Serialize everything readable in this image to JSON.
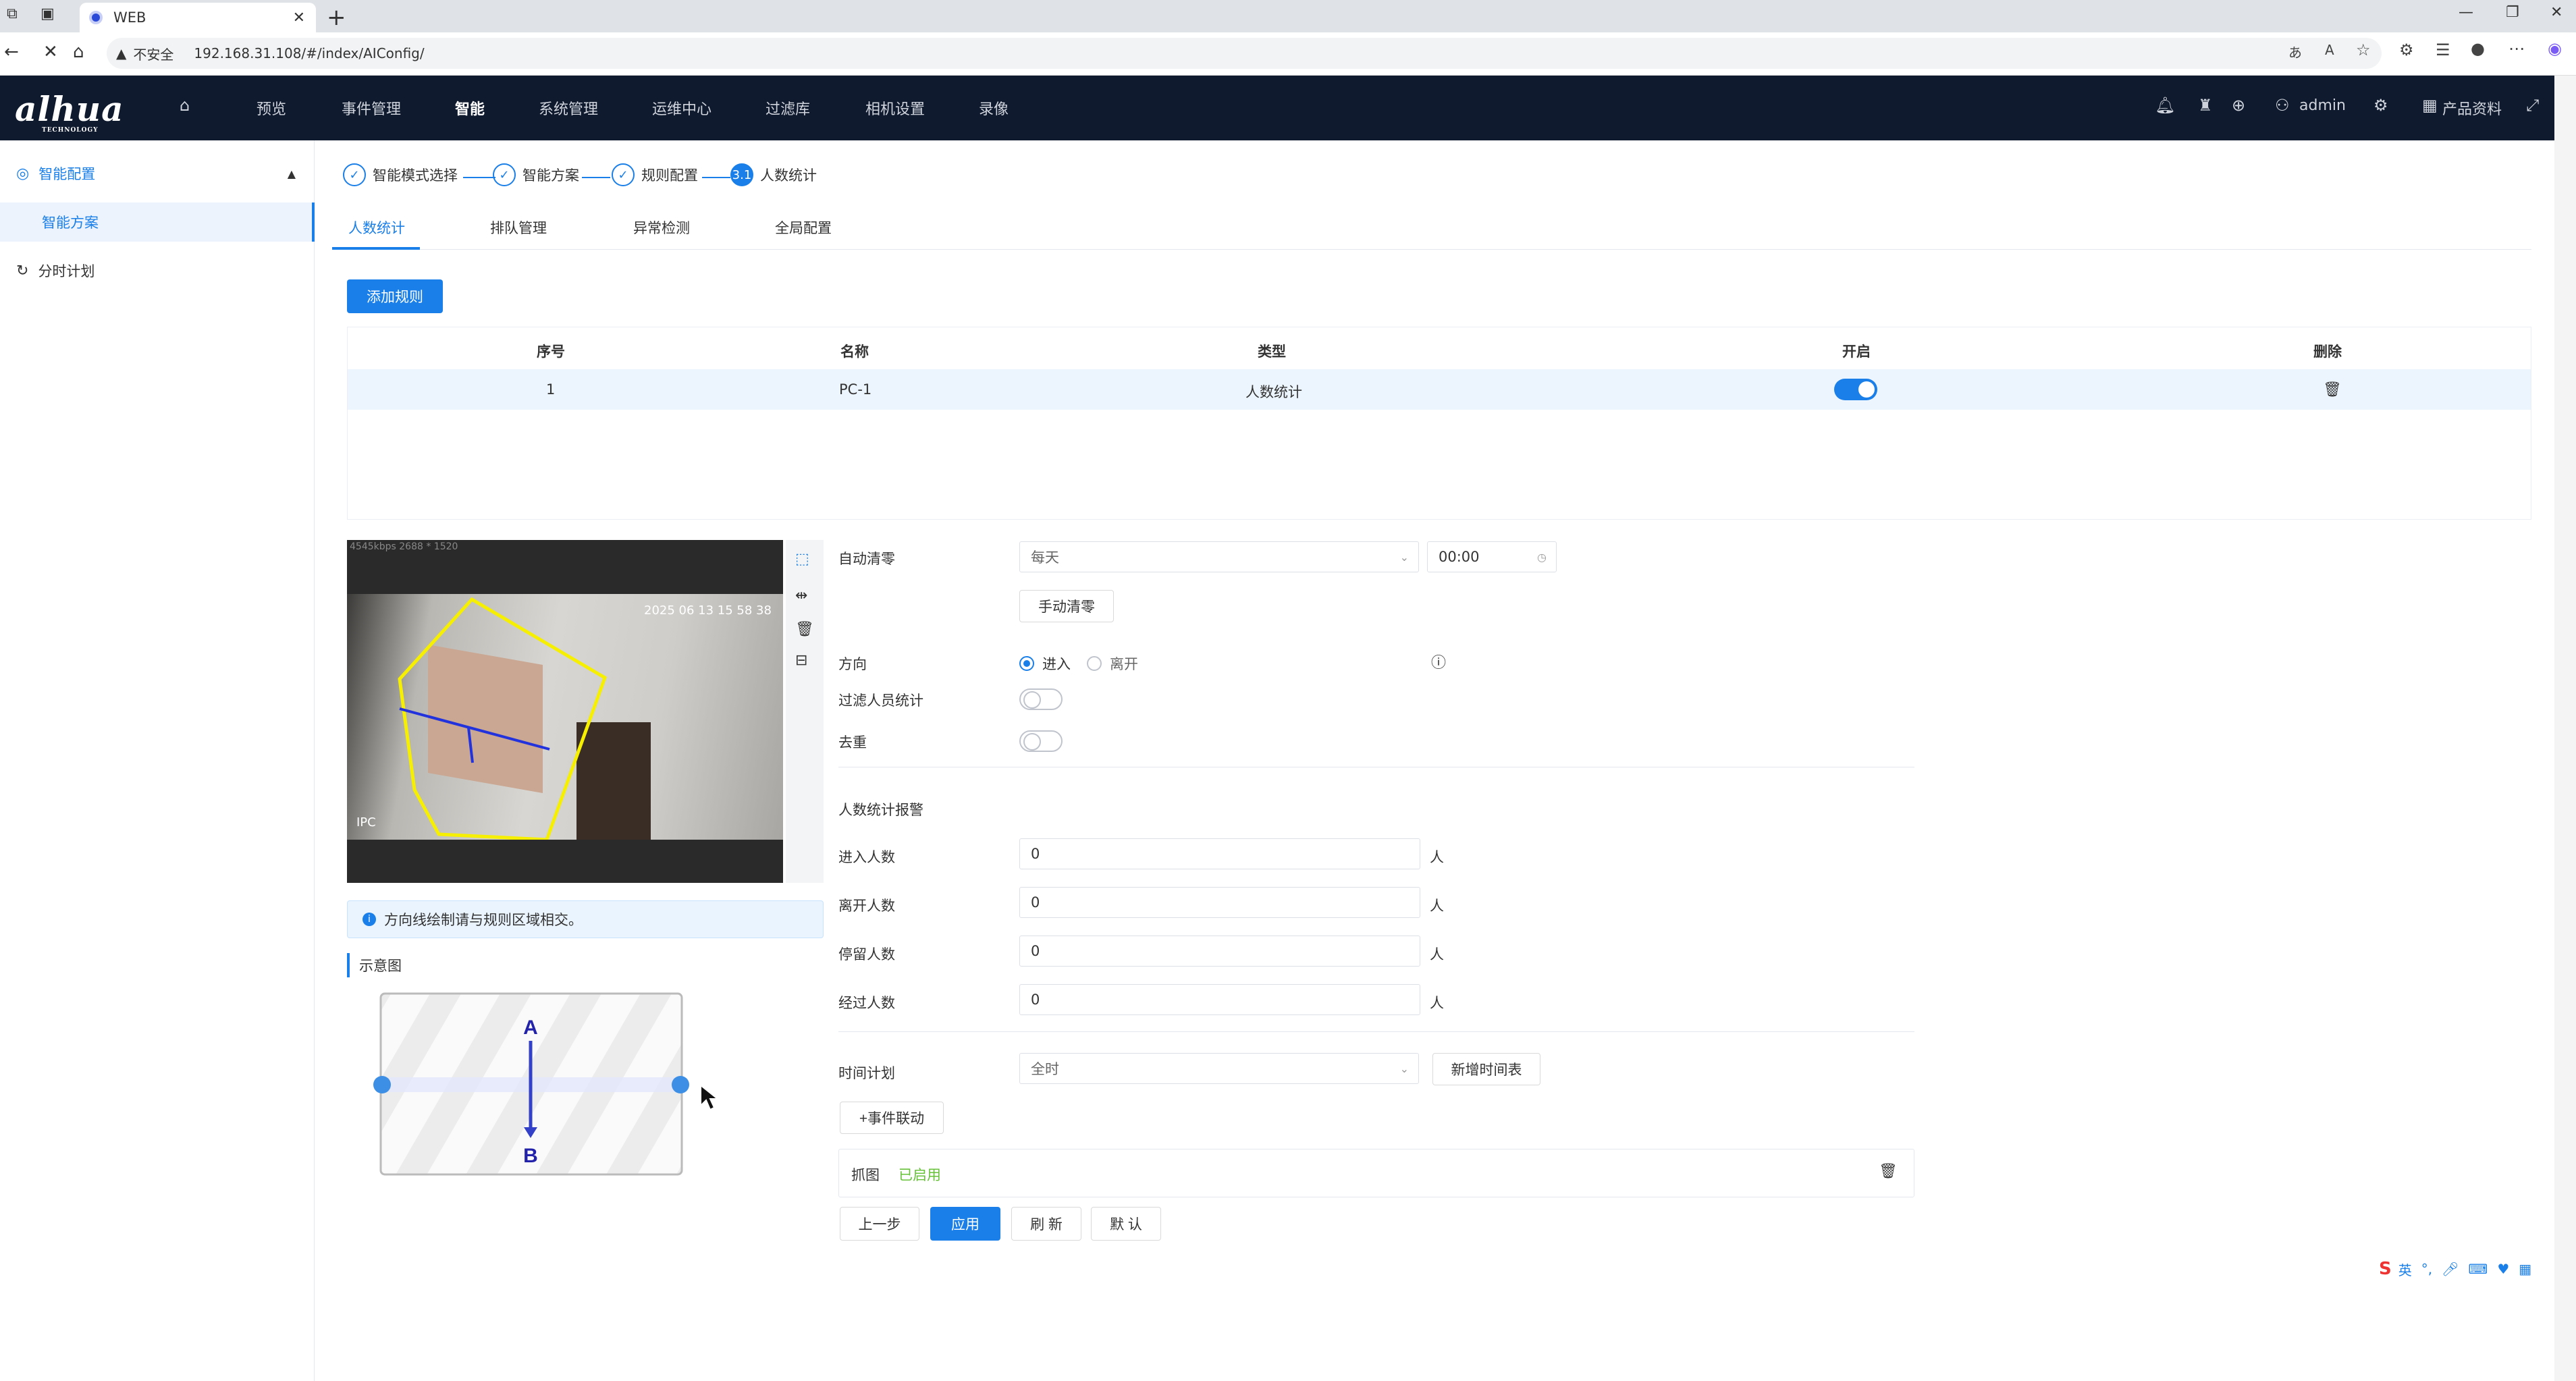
{
  "browser": {
    "tab_title": "WEB",
    "url": "192.168.31.108/#/index/AIConfig/",
    "insecure_label": "不安全",
    "icons": [
      "reload-icon",
      "home-icon",
      "read-aloud-icon",
      "favorite-icon",
      "extensions-icon",
      "collections-icon",
      "profile-icon",
      "more-icon",
      "copilot-icon"
    ]
  },
  "header": {
    "logo": "alhua",
    "logo_sub": "TECHNOLOGY",
    "nav": [
      "预览",
      "事件管理",
      "智能",
      "系统管理",
      "运维中心",
      "过滤库",
      "相机设置",
      "录像"
    ],
    "active_nav": "智能",
    "user": "admin",
    "product_docs": "产品资料"
  },
  "sidebar": {
    "group": "智能配置",
    "sub_item": "智能方案",
    "item2": "分时计划"
  },
  "steps": [
    "智能模式选择",
    "智能方案",
    "规则配置",
    "人数统计"
  ],
  "current_step_badge": "3.1",
  "subtabs": [
    "人数统计",
    "排队管理",
    "异常检测",
    "全局配置"
  ],
  "add_rule": "添加规则",
  "table": {
    "headers": [
      "序号",
      "名称",
      "类型",
      "开启",
      "删除"
    ],
    "rows": [
      {
        "index": "1",
        "name": "PC-1",
        "type": "人数统计",
        "enabled": true
      }
    ]
  },
  "video": {
    "stats": "4545kbps 2688 * 1520",
    "timestamp": "2025 06 13 15 58 38",
    "channel": "IPC"
  },
  "info_text": "方向线绘制请与规则区域相交。",
  "legend_title": "示意图",
  "legend_labels": {
    "a": "A",
    "b": "B"
  },
  "form": {
    "auto_clear_label": "自动清零",
    "auto_clear_value": "每天",
    "auto_clear_time": "00:00",
    "manual_clear": "手动清零",
    "direction_label": "方向",
    "direction_in": "进入",
    "direction_out": "离开",
    "filter_label": "过滤人员统计",
    "dedup_label": "去重",
    "alarm_section": "人数统计报警",
    "in_count_label": "进入人数",
    "in_count": "0",
    "out_count_label": "离开人数",
    "out_count": "0",
    "stay_count_label": "停留人数",
    "stay_count": "0",
    "pass_count_label": "经过人数",
    "pass_count": "0",
    "unit": "人",
    "schedule_label": "时间计划",
    "schedule_value": "全时",
    "add_schedule": "新增时间表",
    "event_link": "+事件联动",
    "snapshot_label": "抓图",
    "snapshot_status": "已启用"
  },
  "buttons": {
    "prev": "上一步",
    "apply": "应用",
    "refresh": "刷 新",
    "default": "默 认"
  },
  "ime": {
    "lang": "英"
  },
  "colors": {
    "primary": "#1a7fe8",
    "header_bg": "#0f1a2e",
    "enabled_text": "#67c23a"
  }
}
